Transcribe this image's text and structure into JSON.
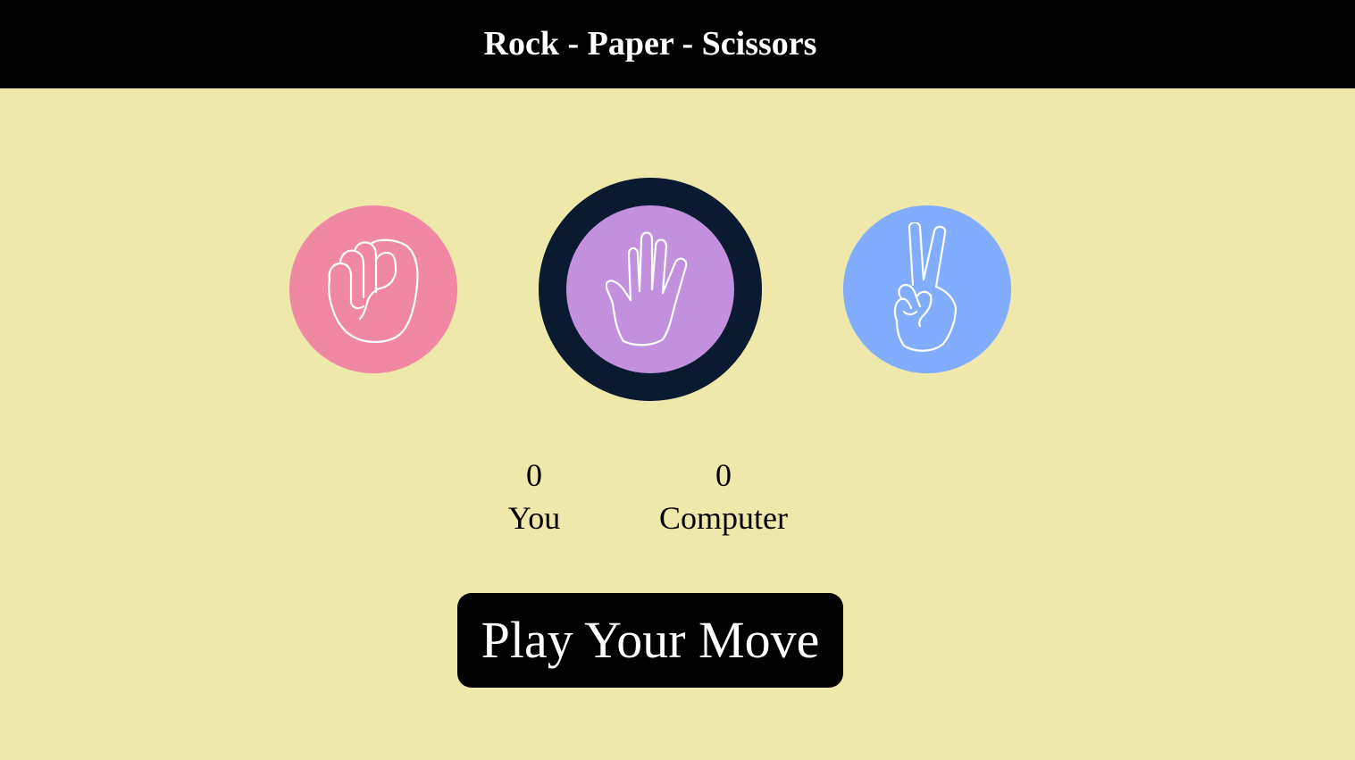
{
  "header": {
    "title": "Rock - Paper - Scissors"
  },
  "choices": [
    {
      "id": "rock",
      "icon": "fist-icon",
      "color": "#f087a3"
    },
    {
      "id": "paper",
      "icon": "open-hand-icon",
      "color": "#c390de",
      "selected": true,
      "ring_color": "#0a1a30"
    },
    {
      "id": "scissors",
      "icon": "peace-hand-icon",
      "color": "#82adff"
    }
  ],
  "scores": {
    "you": {
      "value": "0",
      "label": "You"
    },
    "computer": {
      "value": "0",
      "label": "Computer"
    }
  },
  "play_button": {
    "label": "Play Your Move"
  },
  "colors": {
    "background": "#eee8ab",
    "header": "#000000",
    "text_on_dark": "#ffffff"
  }
}
